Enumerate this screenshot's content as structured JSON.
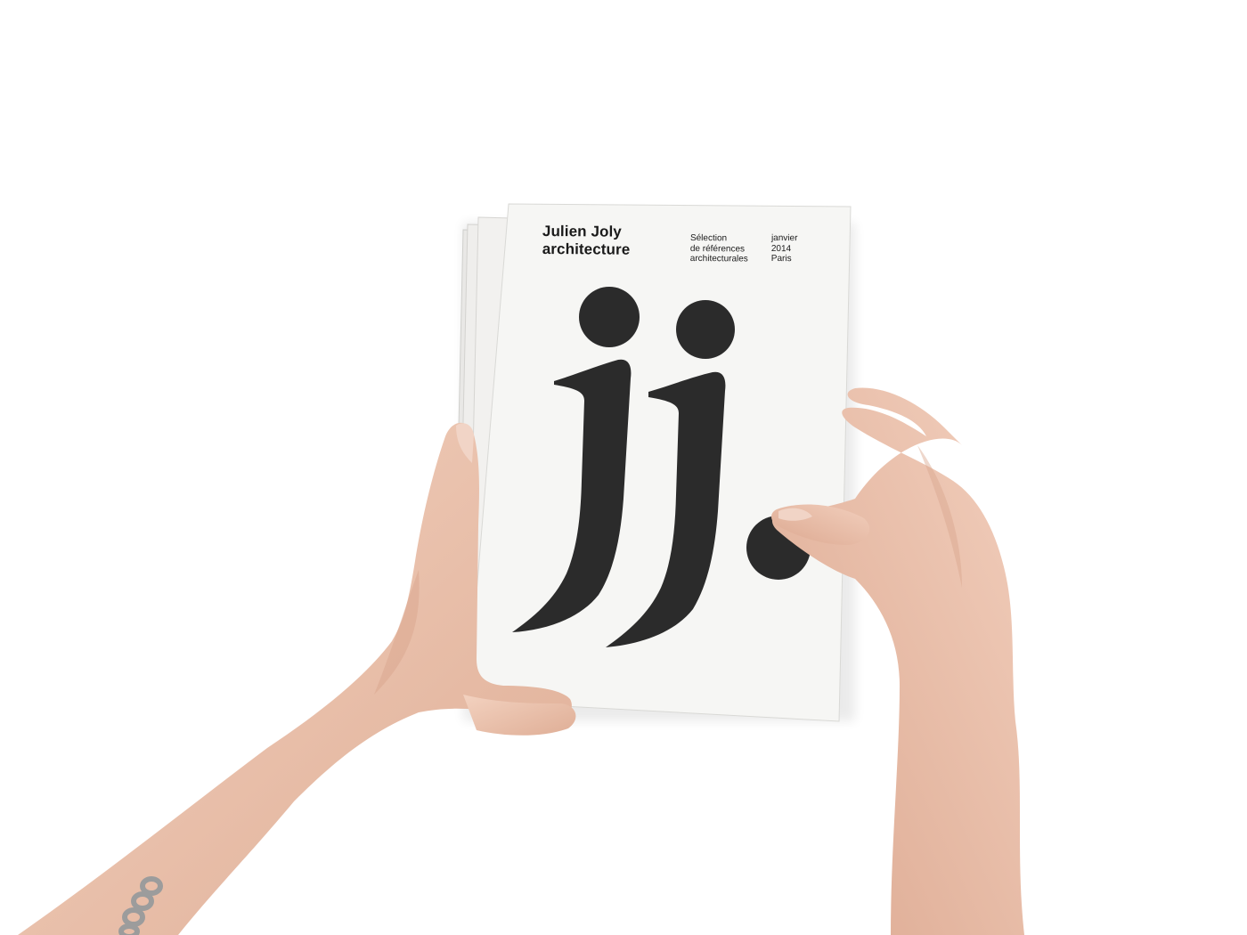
{
  "photo": {
    "background": "#ffffff",
    "subject": "brochure-stack-held-by-hands"
  },
  "brochure": {
    "brand_line_1": "Julien Joly",
    "brand_line_2": "architecture",
    "subtitle_line_1": "Sélection",
    "subtitle_line_2": "de références",
    "subtitle_line_3": "architecturales",
    "date_line_1": "janvier",
    "date_line_2": "2014",
    "location": "Paris",
    "monogram": "jj.",
    "ink_color": "#2b2b2b",
    "paper_color": "#f6f6f4"
  },
  "skin": {
    "tone": "#eec8b3",
    "shade": "#d9a68e",
    "nail": "#f1d4c6"
  },
  "bracelet": {
    "color": "#9c9c9c"
  }
}
